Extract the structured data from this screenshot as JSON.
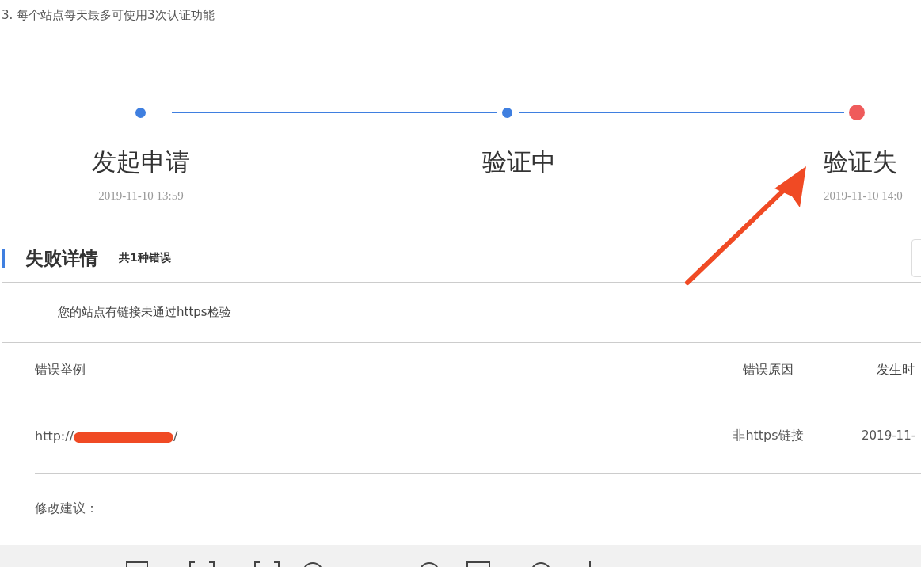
{
  "notice": "3. 每个站点每天最多可使用3次认证功能",
  "steps": [
    {
      "label": "发起申请",
      "time": "2019-11-10 13:59",
      "failed": false
    },
    {
      "label": "验证中",
      "failed": false
    },
    {
      "label": "验证失",
      "time": "2019-11-10 14:0",
      "failed": true
    }
  ],
  "failure": {
    "title": "失败详情",
    "count": "共1种错误",
    "message": "您的站点有链接未通过https检验",
    "table": {
      "columns": [
        "错误举例",
        "错误原因",
        "发生时"
      ],
      "rows": [
        {
          "url_prefix": "http://",
          "url_suffix": "/",
          "redacted": true,
          "reason": "非https链接",
          "time": "2019-11-"
        }
      ]
    },
    "suggestion_label": "修改建议："
  }
}
